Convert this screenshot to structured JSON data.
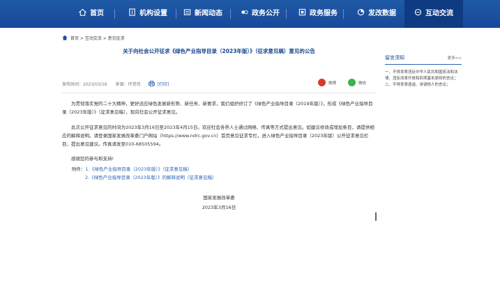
{
  "nav": {
    "items": [
      {
        "label": "首页",
        "icon": "home-icon"
      },
      {
        "label": "机构设置",
        "icon": "building-icon"
      },
      {
        "label": "新闻动态",
        "icon": "news-icon"
      },
      {
        "label": "政务公开",
        "icon": "government-icon"
      },
      {
        "label": "政务服务",
        "icon": "service-icon"
      },
      {
        "label": "发改数据",
        "icon": "data-icon"
      },
      {
        "label": "互动交流",
        "icon": "chat-icon",
        "active": true
      }
    ]
  },
  "breadcrumb": "首页 > 互动交流 > 意见征求",
  "article": {
    "title": "关于向社会公开征求《绿色产业指导目录（2023年版）》（征求意见稿）意见的公告",
    "date_label": "发布时间：2023/03/16",
    "source_label": "来源：环资司",
    "print_label": "[打印]",
    "share_weibo": "微博",
    "share_wechat": "微信",
    "p1": "为贯彻落实党的二十大精神，更好适应绿色发展新形势、新任务、新要求，我们组织修订了《绿色产业指导目录（2019年版）》，形成《绿色产业指导目录（2023年版）》（征求意见稿），现向社会公开征求意见。",
    "p2": "此次公开征求意见的时间为2023年3月16日至2023年4月15日。欢迎社会各界人士通过网络、传真等方式提出意见。如建议修改或增加条目，请提供相应的解释说明。请登录国家发展改革委门户网站（https://www.ndrc.gov.cn）首页意见征求专栏，进入绿色产业指导目录（2023年版）公开征求意见栏目，提出意见建议。传真请发至010-68505594。",
    "p3": "感谢您的参与和支持!",
    "attach_label": "附件：",
    "attach1": "1.《绿色产业指导目录（2023年版）》（征求意见稿）",
    "attach2": "2.《绿色产业指导目录（2023年版）》的解释说明（征求意见稿）",
    "signer": "国家发展改革委",
    "sign_date": "2023年3月16日"
  },
  "sidebar": {
    "title": "留言须知",
    "more": "更多>>",
    "text": "一、不得发表违反中华人民共和国宪法和法律、违反改革开放和四项基本原则的言论；二、不得发表造谣、诽谤他人的言论；"
  },
  "colors": {
    "nav_bg": "#1a4f9f",
    "title": "#14448e",
    "link": "#2a63b8"
  }
}
